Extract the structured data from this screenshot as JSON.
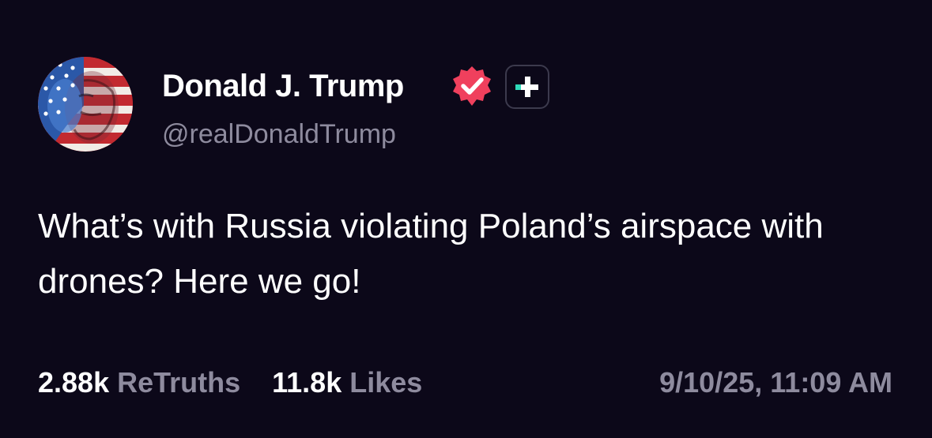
{
  "author": {
    "display_name": "Donald J. Trump",
    "handle": "@realDonaldTrump",
    "avatar_icon": "flag-face-avatar",
    "verified_icon": "verified-check-icon",
    "plus_icon": "truth-plus-icon"
  },
  "post": {
    "text": "What’s with Russia violating Poland’s airspace with drones? Here we go!"
  },
  "stats": {
    "retruths_count": "2.88k",
    "retruths_label": "ReTruths",
    "likes_count": "11.8k",
    "likes_label": "Likes",
    "timestamp": "9/10/25, 11:09 AM"
  },
  "colors": {
    "background": "#0c0819",
    "text_primary": "#ffffff",
    "text_secondary": "#8e8b9e",
    "verified_badge": "#f0405d",
    "plus_accent": "#2fd9b9"
  }
}
